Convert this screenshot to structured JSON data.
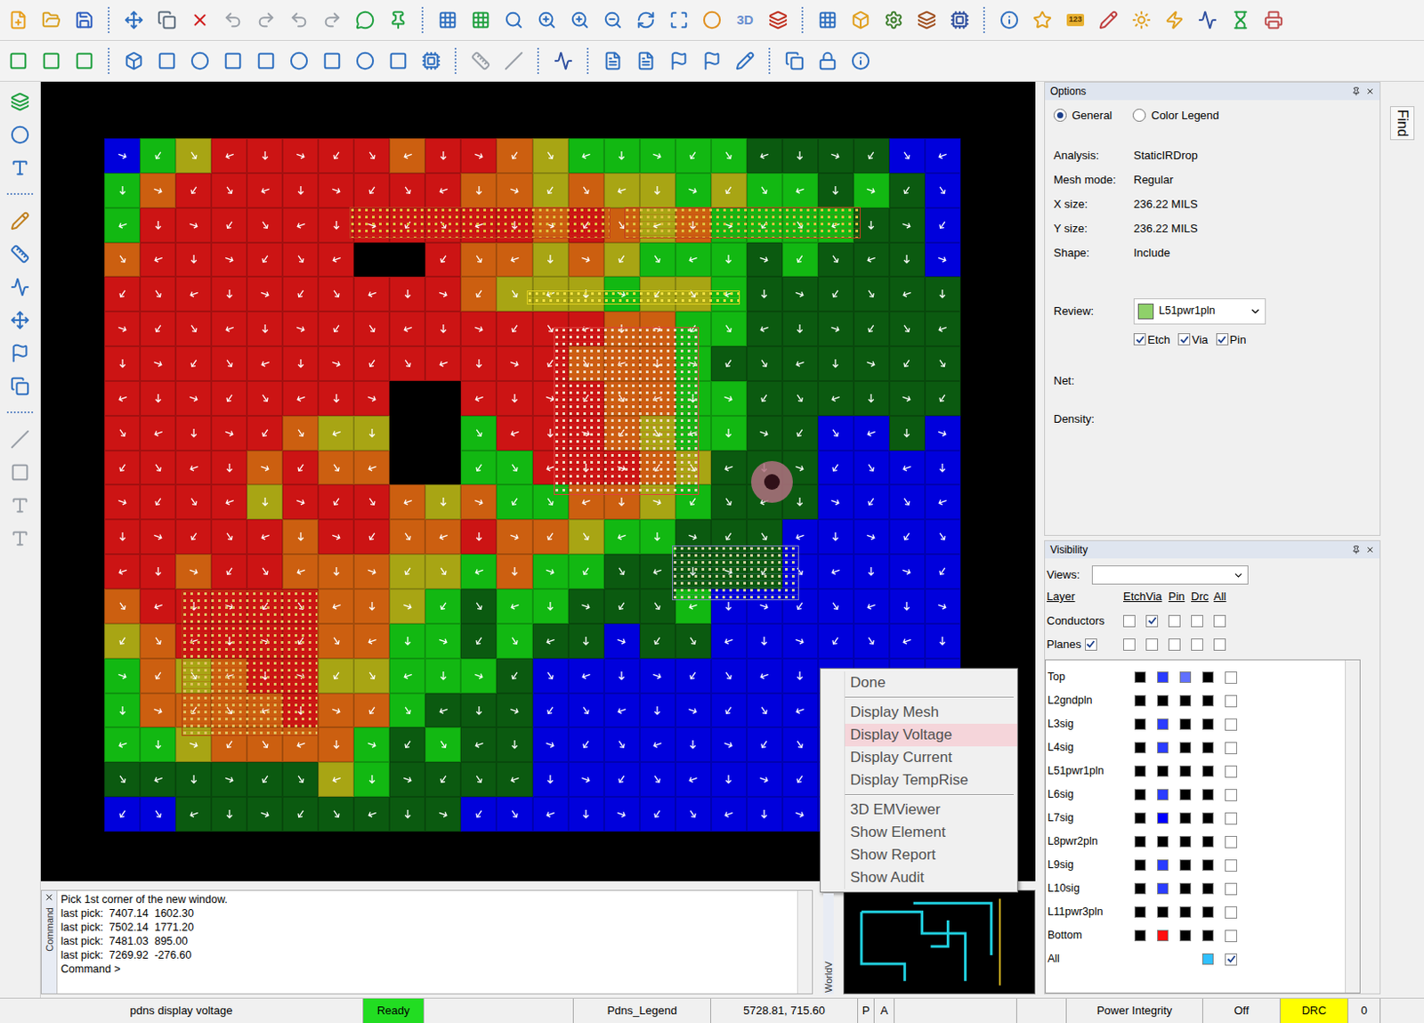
{
  "toolbar": {
    "badges": {
      "three_d": "3D",
      "numbers": "123"
    }
  },
  "canvas": {
    "voltage_bands": [
      [
        0,
        2,
        3,
        5,
        5,
        5,
        5,
        5,
        4,
        5,
        5,
        4,
        3,
        2,
        2,
        2,
        2,
        2,
        1,
        1,
        1,
        1,
        0,
        0
      ],
      [
        2,
        4,
        5,
        5,
        5,
        5,
        5,
        5,
        5,
        5,
        4,
        4,
        3,
        4,
        3,
        3,
        2,
        3,
        2,
        2,
        1,
        2,
        1,
        0
      ],
      [
        2,
        5,
        5,
        5,
        5,
        5,
        5,
        5,
        5,
        5,
        5,
        5,
        4,
        5,
        4,
        3,
        4,
        2,
        2,
        2,
        2,
        1,
        1,
        0
      ],
      [
        4,
        5,
        5,
        5,
        5,
        5,
        5,
        -1,
        -1,
        5,
        4,
        4,
        3,
        4,
        3,
        2,
        2,
        2,
        1,
        2,
        1,
        1,
        1,
        0
      ],
      [
        5,
        5,
        5,
        5,
        5,
        5,
        5,
        5,
        5,
        5,
        4,
        3,
        3,
        3,
        2,
        3,
        3,
        2,
        1,
        1,
        1,
        1,
        1,
        1
      ],
      [
        5,
        5,
        5,
        5,
        5,
        5,
        5,
        5,
        5,
        5,
        5,
        5,
        5,
        5,
        4,
        4,
        2,
        2,
        1,
        1,
        1,
        1,
        1,
        1
      ],
      [
        5,
        5,
        5,
        5,
        5,
        5,
        5,
        5,
        5,
        5,
        5,
        5,
        5,
        4,
        4,
        4,
        2,
        1,
        1,
        1,
        1,
        1,
        1,
        1
      ],
      [
        5,
        5,
        5,
        5,
        5,
        5,
        5,
        5,
        -1,
        -1,
        5,
        5,
        5,
        5,
        4,
        4,
        2,
        2,
        1,
        1,
        1,
        1,
        1,
        1
      ],
      [
        5,
        5,
        5,
        5,
        5,
        4,
        3,
        3,
        -1,
        -1,
        2,
        5,
        5,
        5,
        4,
        3,
        2,
        2,
        1,
        1,
        0,
        0,
        1,
        0
      ],
      [
        5,
        5,
        5,
        5,
        4,
        5,
        4,
        4,
        -1,
        -1,
        2,
        2,
        5,
        5,
        5,
        4,
        3,
        1,
        1,
        1,
        0,
        0,
        0,
        0
      ],
      [
        5,
        5,
        5,
        5,
        3,
        5,
        5,
        5,
        4,
        3,
        4,
        2,
        2,
        4,
        4,
        3,
        2,
        1,
        1,
        1,
        0,
        0,
        0,
        0
      ],
      [
        5,
        5,
        5,
        5,
        5,
        4,
        5,
        5,
        4,
        4,
        5,
        4,
        4,
        3,
        2,
        2,
        1,
        1,
        1,
        0,
        0,
        0,
        0,
        0
      ],
      [
        5,
        5,
        4,
        5,
        5,
        4,
        4,
        4,
        3,
        3,
        2,
        4,
        2,
        2,
        1,
        1,
        1,
        1,
        1,
        0,
        0,
        0,
        0,
        0
      ],
      [
        4,
        5,
        5,
        5,
        5,
        5,
        4,
        4,
        3,
        2,
        1,
        2,
        2,
        1,
        1,
        1,
        2,
        0,
        0,
        0,
        0,
        0,
        0,
        0
      ],
      [
        3,
        4,
        5,
        5,
        5,
        5,
        4,
        4,
        2,
        2,
        1,
        2,
        1,
        1,
        0,
        1,
        1,
        0,
        0,
        0,
        0,
        0,
        0,
        0
      ],
      [
        2,
        4,
        3,
        4,
        5,
        5,
        3,
        3,
        2,
        2,
        2,
        1,
        0,
        0,
        0,
        0,
        0,
        0,
        0,
        0,
        0,
        0,
        0,
        0
      ],
      [
        2,
        4,
        4,
        4,
        4,
        5,
        4,
        4,
        2,
        1,
        1,
        1,
        0,
        0,
        0,
        0,
        0,
        0,
        0,
        0,
        0,
        0,
        0,
        0
      ],
      [
        2,
        2,
        3,
        4,
        4,
        4,
        4,
        2,
        1,
        2,
        1,
        1,
        0,
        0,
        0,
        0,
        0,
        0,
        0,
        0,
        0,
        0,
        0,
        0
      ],
      [
        1,
        1,
        1,
        1,
        1,
        1,
        3,
        2,
        1,
        1,
        1,
        1,
        0,
        0,
        0,
        0,
        0,
        0,
        0,
        0,
        0,
        0,
        0,
        0
      ],
      [
        0,
        0,
        1,
        1,
        1,
        1,
        1,
        1,
        1,
        1,
        0,
        0,
        0,
        0,
        0,
        0,
        0,
        0,
        0,
        0,
        0,
        0,
        0,
        0
      ]
    ]
  },
  "context_menu": {
    "items": [
      {
        "label": "Done",
        "selected": false,
        "separator_after": true
      },
      {
        "label": "Display Mesh",
        "selected": false,
        "separator_after": false
      },
      {
        "label": "Display Voltage",
        "selected": true,
        "separator_after": false
      },
      {
        "label": "Display Current",
        "selected": false,
        "separator_after": false
      },
      {
        "label": "Display TempRise",
        "selected": false,
        "separator_after": true
      },
      {
        "label": "3D EMViewer",
        "selected": false,
        "separator_after": false
      },
      {
        "label": "Show Element",
        "selected": false,
        "separator_after": false
      },
      {
        "label": "Show Report",
        "selected": false,
        "separator_after": false
      },
      {
        "label": "Show Audit",
        "selected": false,
        "separator_after": false
      }
    ]
  },
  "command_window": {
    "side_label": "Command",
    "lines": [
      "Pick 1st corner of the new window.",
      "last pick:  7407.14  1602.30",
      "last pick:  7502.14  1771.20",
      "last pick:  7481.03  895.00",
      "last pick:  7269.92  -276.60",
      "Command >"
    ]
  },
  "world_view": {
    "side_label": "WorldV"
  },
  "options_panel": {
    "title": "Options",
    "modes": [
      {
        "label": "General",
        "selected": true
      },
      {
        "label": "Color Legend",
        "selected": false
      }
    ],
    "fields": [
      {
        "label": "Analysis:",
        "value": "StaticIRDrop"
      },
      {
        "label": "Mesh mode:",
        "value": "Regular"
      },
      {
        "label": "X size:",
        "value": "236.22 MILS"
      },
      {
        "label": "Y size:",
        "value": "236.22 MILS"
      },
      {
        "label": "Shape:",
        "value": "Include"
      }
    ],
    "review": {
      "label": "Review:",
      "value": "L51pwr1pln",
      "color": "#8fd16a"
    },
    "review_filters": [
      {
        "label": "Etch",
        "checked": true
      },
      {
        "label": "Via",
        "checked": true
      },
      {
        "label": "Pin",
        "checked": true
      }
    ],
    "net_label": "Net:",
    "density_label": "Density:"
  },
  "visibility_panel": {
    "title": "Visibility",
    "views_label": "Views:",
    "views_value": "",
    "columns": [
      "Layer",
      "Etch",
      "Via",
      "Pin",
      "Drc",
      "All"
    ],
    "groups": [
      {
        "label": "Conductors",
        "has_master": false,
        "master": false,
        "checks": [
          false,
          true,
          false,
          false,
          false
        ]
      },
      {
        "label": "Planes",
        "has_master": true,
        "master": true,
        "checks": [
          false,
          false,
          false,
          false,
          false
        ]
      }
    ],
    "layers": [
      {
        "name": "Top",
        "swatches": [
          "#000000",
          "#2a3cff",
          "#6070ff",
          "#000000"
        ],
        "all": false
      },
      {
        "name": "L2gndpln",
        "swatches": [
          "#000000",
          "#000000",
          "#000000",
          "#000000"
        ],
        "all": false
      },
      {
        "name": "L3sig",
        "swatches": [
          "#000000",
          "#2a3cff",
          "#000000",
          "#000000"
        ],
        "all": false
      },
      {
        "name": "L4sig",
        "swatches": [
          "#000000",
          "#2a3cff",
          "#000000",
          "#000000"
        ],
        "all": false
      },
      {
        "name": "L51pwr1pln",
        "swatches": [
          "#000000",
          "#000000",
          "#000000",
          "#000000"
        ],
        "all": false
      },
      {
        "name": "L6sig",
        "swatches": [
          "#000000",
          "#2a3cff",
          "#000000",
          "#000000"
        ],
        "all": false
      },
      {
        "name": "L7sig",
        "swatches": [
          "#000000",
          "#0000ff",
          "#000000",
          "#000000"
        ],
        "all": false
      },
      {
        "name": "L8pwr2pln",
        "swatches": [
          "#000000",
          "#000000",
          "#000000",
          "#000000"
        ],
        "all": false
      },
      {
        "name": "L9sig",
        "swatches": [
          "#000000",
          "#2a3cff",
          "#000000",
          "#000000"
        ],
        "all": false
      },
      {
        "name": "L10sig",
        "swatches": [
          "#000000",
          "#2a3cff",
          "#000000",
          "#000000"
        ],
        "all": false
      },
      {
        "name": "L11pwr3pln",
        "swatches": [
          "#000000",
          "#000000",
          "#000000",
          "#000000"
        ],
        "all": false
      },
      {
        "name": "Bottom",
        "swatches": [
          "#000000",
          "#ff1010",
          "#000000",
          "#000000"
        ],
        "all": false
      },
      {
        "name": "All",
        "swatches": [
          "",
          "",
          "",
          "#30c0ff"
        ],
        "all": true
      }
    ]
  },
  "find_tab": "Find",
  "status_bar": {
    "cells": [
      {
        "text": "pdns display voltage",
        "color": "#f0f0f0"
      },
      {
        "text": "Ready",
        "color": "#22dd22"
      },
      {
        "text": "",
        "color": "#f0f0f0"
      },
      {
        "text": "Pdns_Legend",
        "color": "#f0f0f0"
      },
      {
        "text": "5728.81, 715.60",
        "color": "#f0f0f0"
      },
      {
        "text": "P",
        "color": "#f0f0f0"
      },
      {
        "text": "A",
        "color": "#f0f0f0"
      },
      {
        "text": "",
        "color": "#f0f0f0"
      },
      {
        "text": "",
        "color": "#f0f0f0"
      },
      {
        "text": "Power Integrity",
        "color": "#f0f0f0"
      },
      {
        "text": "Off",
        "color": "#f0f0f0"
      },
      {
        "text": "DRC",
        "color": "#ffff00"
      },
      {
        "text": "0",
        "color": "#f0f0f0"
      }
    ]
  }
}
